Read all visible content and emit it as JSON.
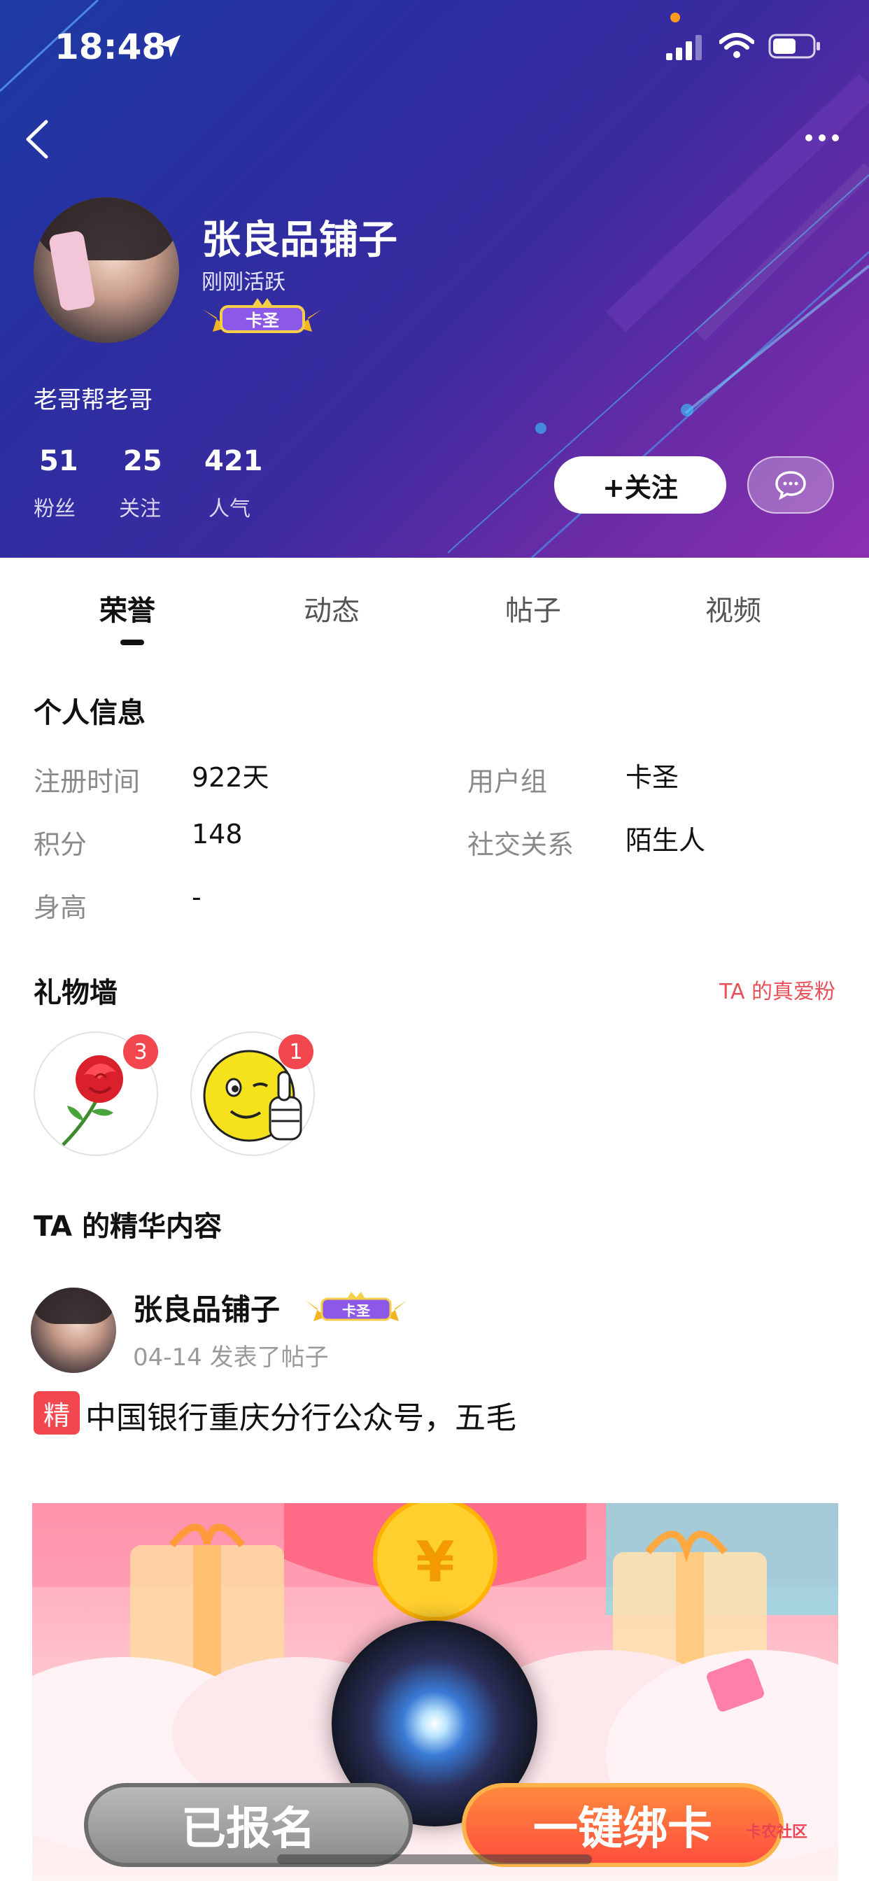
{
  "status_bar": {
    "time": "18:48"
  },
  "profile": {
    "username": "张良品铺子",
    "activity": "刚刚活跃",
    "badge": "卡圣",
    "bio": "老哥帮老哥",
    "stats": [
      {
        "value": "51",
        "label": "粉丝"
      },
      {
        "value": "25",
        "label": "关注"
      },
      {
        "value": "421",
        "label": "人气"
      }
    ],
    "follow_label": "+关注"
  },
  "tabs": [
    {
      "label": "荣誉",
      "active": true
    },
    {
      "label": "动态"
    },
    {
      "label": "帖子"
    },
    {
      "label": "视频"
    }
  ],
  "info": {
    "title": "个人信息",
    "reg_label": "注册时间",
    "reg_value": "922天",
    "group_label": "用户组",
    "group_value": "卡圣",
    "points_label": "积分",
    "points_value": "148",
    "social_label": "社交关系",
    "social_value": "陌生人",
    "height_label": "身高",
    "height_value": "-"
  },
  "gifts": {
    "title": "礼物墙",
    "link": "TA 的真爱粉",
    "items": [
      {
        "icon": "rose-icon",
        "count": "3"
      },
      {
        "icon": "thumbs-up-smiley-icon",
        "count": "1"
      }
    ]
  },
  "featured": {
    "title": "TA 的精华内容",
    "author": "张良品铺子",
    "badge": "卡圣",
    "meta": "04-14 发表了帖子",
    "tag": "精",
    "post_title": "中国银行重庆分行公众号，五毛"
  },
  "banner": {
    "registered_label": "已报名",
    "bind_label": "一键绑卡",
    "watermark": "卡农社区"
  },
  "colors": {
    "accent_red": "#f2474f",
    "link_red": "#e8515a",
    "header_gradient_start": "#1d3aa3",
    "header_gradient_end": "#8b2fb0"
  }
}
